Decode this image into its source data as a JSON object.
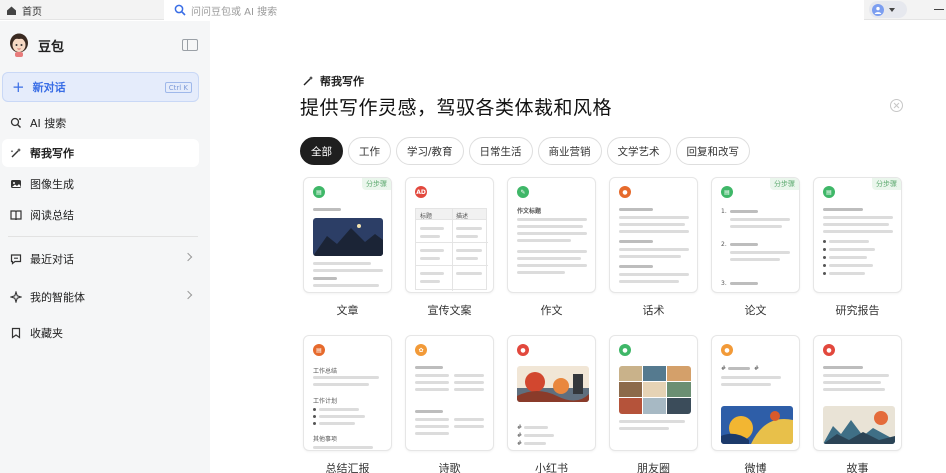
{
  "topbar": {
    "home_tab": "首页",
    "search_placeholder": "问问豆包或 AI 搜索"
  },
  "sidebar": {
    "brand": "豆包",
    "new_chat": "新对话",
    "new_chat_shortcut": "Ctrl K",
    "items": [
      {
        "label": "AI 搜索",
        "icon": "ai-search-icon"
      },
      {
        "label": "帮我写作",
        "icon": "pen-sparkle-icon"
      },
      {
        "label": "图像生成",
        "icon": "image-icon"
      },
      {
        "label": "阅读总结",
        "icon": "book-icon"
      }
    ],
    "groups": [
      {
        "label": "最近对话",
        "icon": "chat-bubble-icon"
      },
      {
        "label": "我的智能体",
        "icon": "sparkle-icon"
      },
      {
        "label": "收藏夹",
        "icon": "bookmark-icon"
      }
    ]
  },
  "main": {
    "eyebrow": "帮我写作",
    "headline": "提供写作灵感，驾驭各类体裁和风格",
    "chips": [
      "全部",
      "工作",
      "学习/教育",
      "日常生活",
      "商业营销",
      "文学艺术",
      "回复和改写"
    ],
    "selected_chip": "全部",
    "cards_row1": [
      {
        "label": "文章",
        "tag": "分步骤",
        "badge_color": "#3fb768"
      },
      {
        "label": "宣传文案",
        "tag": "",
        "badge_color": "#e2483d",
        "badge_text": "AD",
        "col1": "标题",
        "col2": "描述"
      },
      {
        "label": "作文",
        "tag": "",
        "badge_color": "#3fb768",
        "doc_title": "作文标题"
      },
      {
        "label": "话术",
        "tag": "",
        "badge_color": "#e66a2c"
      },
      {
        "label": "论文",
        "tag": "分步骤",
        "badge_color": "#3fb768",
        "numbers": [
          "1.",
          "2.",
          "3."
        ]
      },
      {
        "label": "研究报告",
        "tag": "分步骤",
        "badge_color": "#3fb768"
      }
    ],
    "cards_row2": [
      {
        "label": "总结汇报",
        "badge_color": "#e66a2c",
        "lines": [
          "工作总结",
          "工作计划",
          "其他事项"
        ]
      },
      {
        "label": "诗歌",
        "badge_color": "#f29a38"
      },
      {
        "label": "小红书",
        "badge_color": "#e2483d"
      },
      {
        "label": "朋友圈",
        "badge_color": "#3fb768"
      },
      {
        "label": "微博",
        "badge_color": "#f29a38"
      },
      {
        "label": "故事",
        "badge_color": "#e2483d"
      }
    ]
  }
}
